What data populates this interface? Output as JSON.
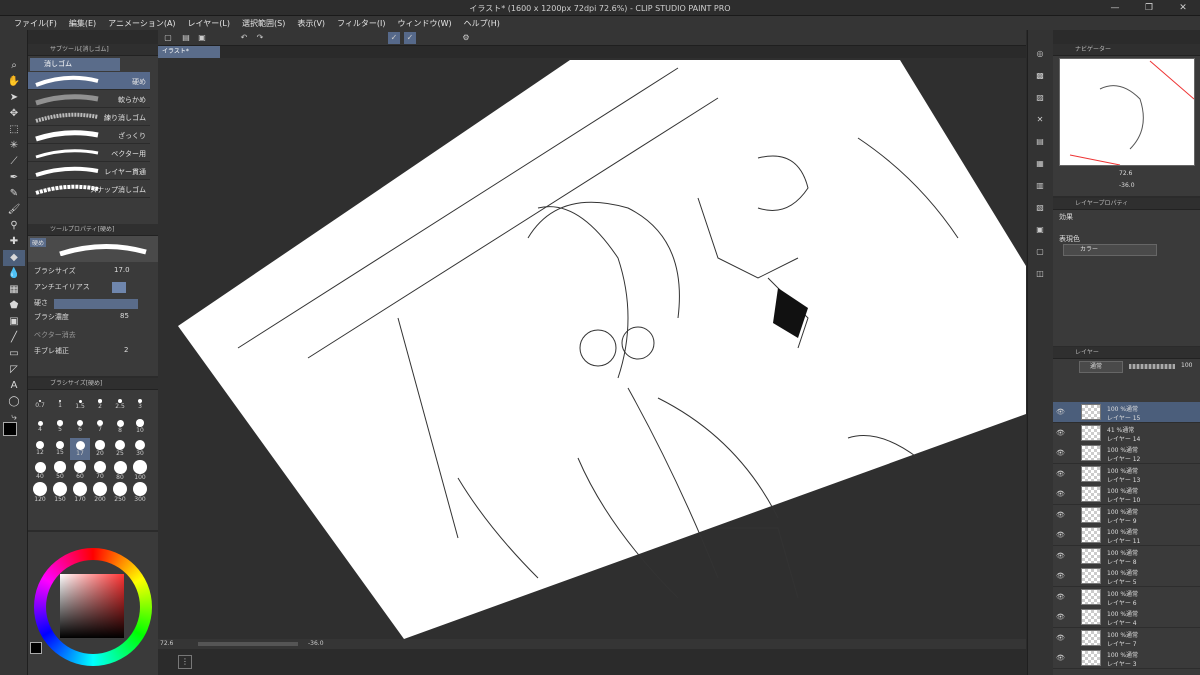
{
  "window": {
    "title": "イラスト* (1600 x 1200px 72dpi 72.6%) - CLIP STUDIO PAINT PRO"
  },
  "menu": [
    "ファイル(F)",
    "編集(E)",
    "アニメーション(A)",
    "レイヤー(L)",
    "選択範囲(S)",
    "表示(V)",
    "フィルター(I)",
    "ウィンドウ(W)",
    "ヘルプ(H)"
  ],
  "subtool": {
    "header": "サブツール[消しゴム]",
    "group": "消しゴム",
    "brushes": [
      "硬め",
      "軟らかめ",
      "練り消しゴム",
      "ざっくり",
      "ベクター用",
      "レイヤー貫通",
      "スナップ消しゴム"
    ]
  },
  "toolprop": {
    "header": "ツールプロパティ[硬め]",
    "name": "硬め",
    "brush_size_label": "ブラシサイズ",
    "brush_size": "17.0",
    "antialias_label": "アンチエイリアス",
    "hardness_label": "硬さ",
    "density_label": "ブラシ濃度",
    "density": "85",
    "vector_label": "ベクター消去",
    "stabilize_label": "手ブレ補正",
    "stabilize": "2"
  },
  "brushsize": {
    "header": "ブラシサイズ[硬め]",
    "sizes": [
      "0.7",
      "1",
      "1.5",
      "2",
      "2.5",
      "3",
      "4",
      "5",
      "6",
      "7",
      "8",
      "10",
      "12",
      "15",
      "17",
      "20",
      "25",
      "30",
      "40",
      "50",
      "60",
      "70",
      "80",
      "100",
      "120",
      "150",
      "170",
      "200",
      "250",
      "300"
    ]
  },
  "canvas": {
    "tab": "イラスト*"
  },
  "status": {
    "zoom": "72.6",
    "angle": "-36.0"
  },
  "navigator": {
    "header": "ナビゲーター",
    "zoom": "72.6",
    "angle": "-36.0"
  },
  "layerprop": {
    "header": "レイヤープロパティ",
    "effect_label": "効果",
    "color_label": "表現色",
    "color_value": "カラー"
  },
  "layers": {
    "header": "レイヤー",
    "blend": "通常",
    "opacity": "100",
    "items": [
      {
        "mode": "100 %通常",
        "name": "レイヤー 15",
        "selected": true
      },
      {
        "mode": "41 %通常",
        "name": "レイヤー 14"
      },
      {
        "mode": "100 %通常",
        "name": "レイヤー 12"
      },
      {
        "mode": "100 %通常",
        "name": "レイヤー 13"
      },
      {
        "mode": "100 %通常",
        "name": "レイヤー 10"
      },
      {
        "mode": "100 %通常",
        "name": "レイヤー 9"
      },
      {
        "mode": "100 %通常",
        "name": "レイヤー 11"
      },
      {
        "mode": "100 %通常",
        "name": "レイヤー 8"
      },
      {
        "mode": "100 %通常",
        "name": "レイヤー 5"
      },
      {
        "mode": "100 %通常",
        "name": "レイヤー 6"
      },
      {
        "mode": "100 %通常",
        "name": "レイヤー 4"
      },
      {
        "mode": "100 %通常",
        "name": "レイヤー 7"
      },
      {
        "mode": "100 %通常",
        "name": "レイヤー 3"
      }
    ]
  },
  "colors": {
    "accent": "#4b5e7b",
    "panel": "#3a3a3a"
  }
}
